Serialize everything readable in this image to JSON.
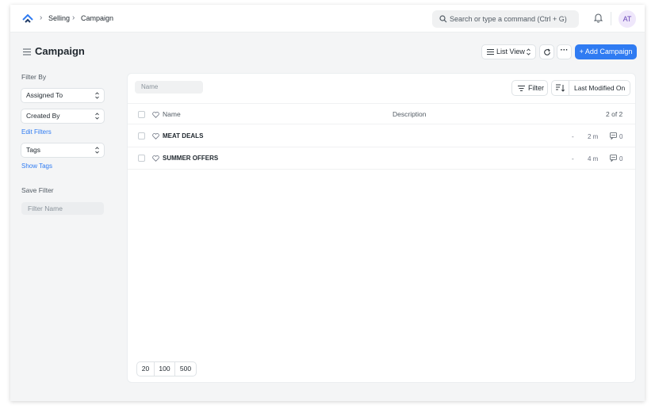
{
  "breadcrumbs": [
    "Selling",
    "Campaign"
  ],
  "search": {
    "placeholder": "Search or type a command (Ctrl + G)"
  },
  "user": {
    "initials": "AT"
  },
  "page": {
    "title": "Campaign",
    "list_view_label": "List View",
    "more_label": "···",
    "add_label": "+ Add Campaign"
  },
  "sidebar": {
    "filter_by": "Filter By",
    "assigned_to": "Assigned To",
    "created_by": "Created By",
    "edit_filters": "Edit Filters",
    "tags": "Tags",
    "show_tags": "Show Tags",
    "save_filter": "Save Filter",
    "filter_name_placeholder": "Filter Name"
  },
  "list": {
    "name_placeholder": "Name",
    "filter_label": "Filter",
    "sort_label": "Last Modified On",
    "columns": {
      "name": "Name",
      "description": "Description"
    },
    "count": "2 of 2",
    "rows": [
      {
        "title": "MEAT DEALS",
        "description": "-",
        "modified": "2 m",
        "comments": "0"
      },
      {
        "title": "SUMMER OFFERS",
        "description": "-",
        "modified": "4 m",
        "comments": "0"
      }
    ],
    "page_sizes": [
      "20",
      "100",
      "500"
    ]
  },
  "colors": {
    "primary": "#2f7bf2",
    "avatar_bg": "#efe7fb",
    "avatar_fg": "#6846b7"
  }
}
